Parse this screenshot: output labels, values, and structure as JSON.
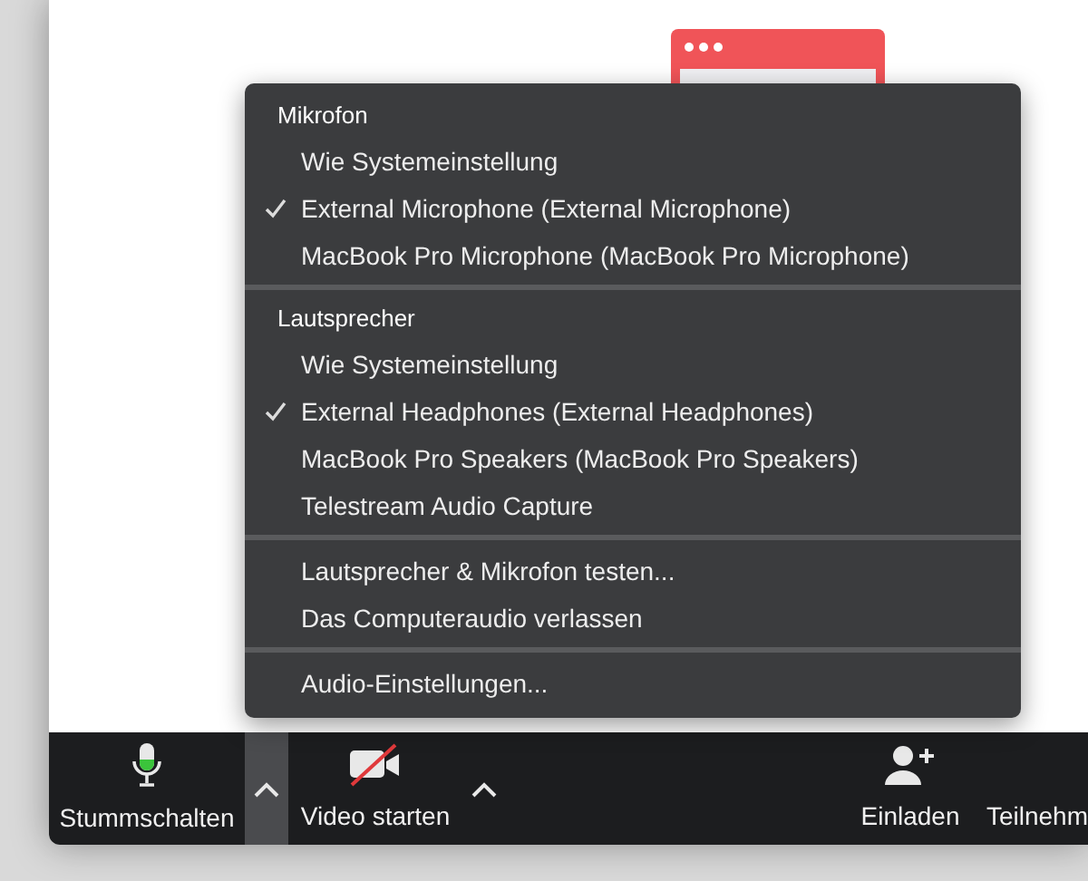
{
  "audio_menu": {
    "sections": [
      {
        "heading": "Mikrofon",
        "items": [
          {
            "label": "Wie Systemeinstellung",
            "checked": false
          },
          {
            "label": "External Microphone (External Microphone)",
            "checked": true
          },
          {
            "label": "MacBook Pro Microphone (MacBook Pro Microphone)",
            "checked": false
          }
        ]
      },
      {
        "heading": "Lautsprecher",
        "items": [
          {
            "label": "Wie Systemeinstellung",
            "checked": false
          },
          {
            "label": "External Headphones (External Headphones)",
            "checked": true
          },
          {
            "label": "MacBook Pro Speakers (MacBook Pro Speakers)",
            "checked": false
          },
          {
            "label": "Telestream Audio Capture",
            "checked": false
          }
        ]
      },
      {
        "items": [
          {
            "label": "Lautsprecher & Mikrofon testen...",
            "checked": false
          },
          {
            "label": "Das Computeraudio verlassen",
            "checked": false
          }
        ]
      },
      {
        "items": [
          {
            "label": "Audio-Einstellungen...",
            "checked": false
          }
        ]
      }
    ]
  },
  "toolbar": [
    {
      "kind": "mute",
      "label": "Stummschalten"
    },
    {
      "kind": "caret",
      "selected": true
    },
    {
      "kind": "video",
      "label": "Video starten"
    },
    {
      "kind": "caret",
      "selected": false
    },
    {
      "kind": "spacer"
    },
    {
      "kind": "invite",
      "label": "Einladen"
    },
    {
      "kind": "participants",
      "label": "Teilnehm"
    }
  ]
}
